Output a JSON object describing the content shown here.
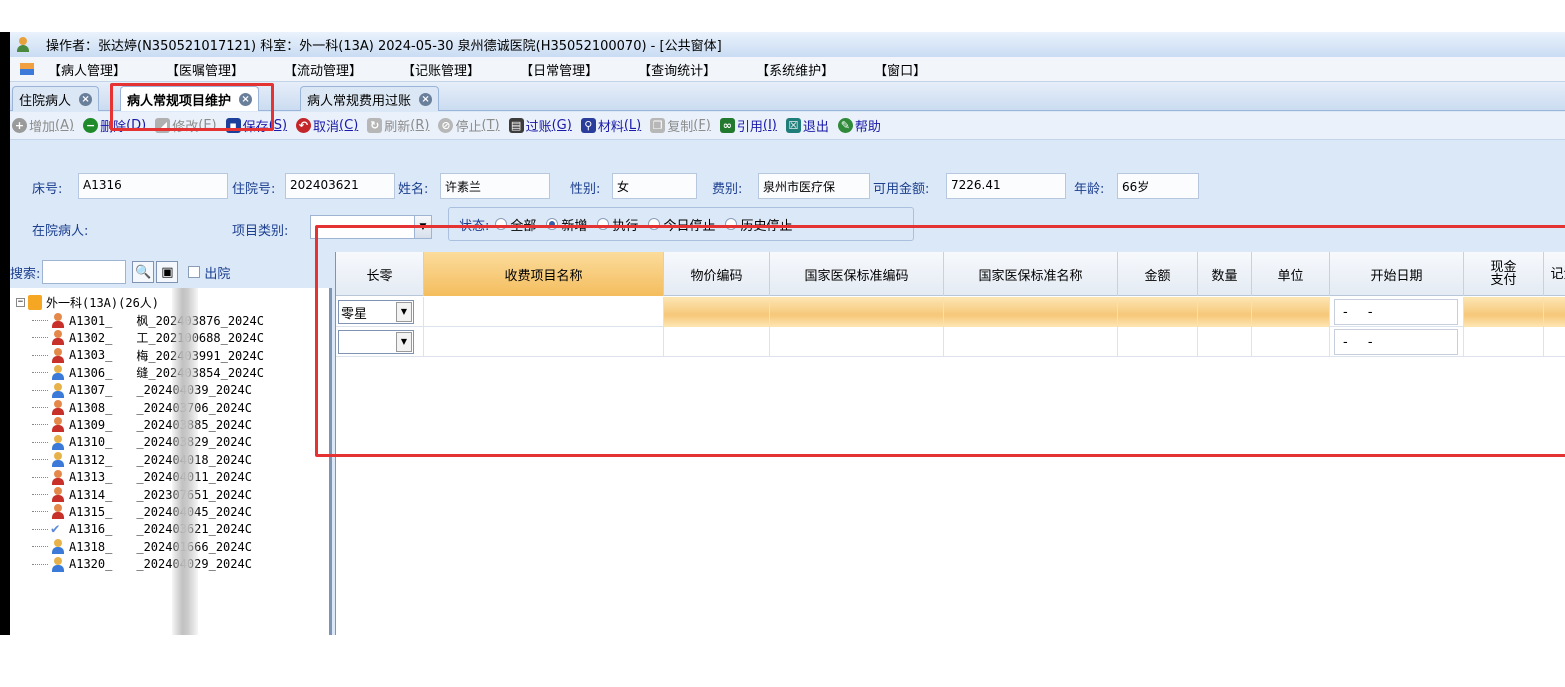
{
  "titlebar": {
    "text": "操作者：张达婷(N350521017121)  科室：外一科(13A)  2024-05-30  泉州德诚医院(H35052100070) - [公共窗体]"
  },
  "menu": [
    "【病人管理】",
    "【医嘱管理】",
    "【流动管理】",
    "【记账管理】",
    "【日常管理】",
    "【查询统计】",
    "【系统维护】",
    "【窗口】"
  ],
  "tabs": [
    {
      "label": "住院病人"
    },
    {
      "label": "病人常规项目维护"
    },
    {
      "label": "病人常规费用过账"
    }
  ],
  "toolbar": {
    "add": {
      "text": "增加",
      "key": "(A)"
    },
    "delete": {
      "text": "删除",
      "key": "(D)"
    },
    "edit": {
      "text": "修改",
      "key": "(E)"
    },
    "save": {
      "text": "保存",
      "key": "(S)"
    },
    "cancel": {
      "text": "取消",
      "key": "(C)"
    },
    "refresh": {
      "text": "刷新",
      "key": "(R)"
    },
    "stop": {
      "text": "停止",
      "key": "(T)"
    },
    "post": {
      "text": "过账",
      "key": "(G)"
    },
    "material": {
      "text": "材料",
      "key": "(L)"
    },
    "copy": {
      "text": "复制",
      "key": "(F)"
    },
    "quote": {
      "text": "引用",
      "key": "(I)"
    },
    "exit": {
      "text": "退出"
    },
    "help": {
      "text": "帮助"
    }
  },
  "form": {
    "bed_label": "床号:",
    "bed_value": "A1316",
    "admission_label": "住院号:",
    "admission_value": "202403621",
    "name_label": "姓名:",
    "name_value": "许素兰",
    "gender_label": "性别:",
    "gender_value": "女",
    "fee_type_label": "费别:",
    "fee_type_value": "泉州市医疗保",
    "balance_label": "可用金额:",
    "balance_value": "7226.41",
    "age_label": "年龄:",
    "age_value": "66岁",
    "inpatient_label": "在院病人:",
    "category_label": "项目类别:",
    "status_label": "状态:",
    "status_options": [
      "全部",
      "新增",
      "执行",
      "今日停止",
      "历史停止"
    ],
    "status_selected": "新增"
  },
  "search": {
    "label": "搜索:",
    "discharged_label": "出院"
  },
  "tree": {
    "root": "外一科(13A)(26人)",
    "patients": [
      {
        "text": "A1301_",
        "tail": "枫_202403876_2024C",
        "icon": "female"
      },
      {
        "text": "A1302_",
        "tail": "工_202100688_2024C",
        "icon": "female"
      },
      {
        "text": "A1303_",
        "tail": "梅_202403991_2024C",
        "icon": "female"
      },
      {
        "text": "A1306_",
        "tail": "缝_202403854_2024C",
        "icon": "male"
      },
      {
        "text": "A1307_",
        "tail": "_202404039_2024C",
        "icon": "male"
      },
      {
        "text": "A1308_",
        "tail": "_202403706_2024C",
        "icon": "female"
      },
      {
        "text": "A1309_",
        "tail": "_202403885_2024C",
        "icon": "female"
      },
      {
        "text": "A1310_",
        "tail": "_202403829_2024C",
        "icon": "male"
      },
      {
        "text": "A1312_",
        "tail": "_202404018_2024C",
        "icon": "male"
      },
      {
        "text": "A1313_",
        "tail": "_202404011_2024C",
        "icon": "female"
      },
      {
        "text": "A1314_",
        "tail": "_202307651_2024C",
        "icon": "female"
      },
      {
        "text": "A1315_",
        "tail": "_202404045_2024C",
        "icon": "female"
      },
      {
        "text": "A1316_",
        "tail": "_202403621_2024C",
        "icon": "checked"
      },
      {
        "text": "A1318_",
        "tail": "_202401666_2024C",
        "icon": "male"
      },
      {
        "text": "A1320_",
        "tail": "_202404029_2024C",
        "icon": "male"
      }
    ]
  },
  "grid": {
    "columns": [
      "长零",
      "收费项目名称",
      "物价编码",
      "国家医保标准编码",
      "国家医保标准名称",
      "金额",
      "数量",
      "单位",
      "开始日期",
      "现金支付",
      "记金"
    ],
    "rows": [
      {
        "type": "零星",
        "date": "- -"
      },
      {
        "type": "",
        "date": "- -"
      }
    ]
  },
  "colors": {
    "highlight_box": "#e53232",
    "selected_header": "#f4bd5e",
    "label_blue": "#1c3f8f"
  }
}
